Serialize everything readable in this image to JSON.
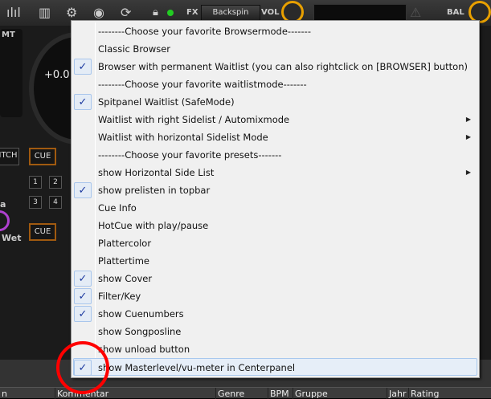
{
  "topbar": {
    "fx_label": "FX",
    "fx_effect": "Backspin",
    "vol_label": "VOL",
    "bal_label": "BAL",
    "icons": [
      "waveform-icon",
      "mixer-icon",
      "gear-icon",
      "eye-icon",
      "refresh-icon",
      "lock-icon",
      "status-led-icon"
    ]
  },
  "deck": {
    "mt_label": "MT",
    "pitch_value": "+0.0",
    "pitch_btn": "ITCH",
    "cue_label": "CUE",
    "cue2_label": "CUE",
    "hotcues": [
      "1",
      "2",
      "3",
      "4"
    ],
    "fx_label_a": "a",
    "wet_label": "Wet"
  },
  "menu": {
    "items": [
      {
        "label": "--------Choose your favorite Browsermode-------",
        "checked": false,
        "submenu": false
      },
      {
        "label": "Classic Browser",
        "checked": false,
        "submenu": false
      },
      {
        "label": "Browser with permanent Waitlist (you can also rightclick on [BROWSER] button)",
        "checked": true,
        "submenu": false
      },
      {
        "label": "--------Choose your favorite waitlistmode-------",
        "checked": false,
        "submenu": false
      },
      {
        "label": "Spitpanel Waitlist (SafeMode)",
        "checked": true,
        "submenu": false
      },
      {
        "label": "Waitlist with right Sidelist / Automixmode",
        "checked": false,
        "submenu": true
      },
      {
        "label": "Waitlist with horizontal Sidelist Mode",
        "checked": false,
        "submenu": true
      },
      {
        "label": "--------Choose your favorite presets-------",
        "checked": false,
        "submenu": false
      },
      {
        "label": "show Horizontal Side List",
        "checked": false,
        "submenu": true
      },
      {
        "label": "show prelisten in topbar",
        "checked": true,
        "submenu": false
      },
      {
        "label": "Cue Info",
        "checked": false,
        "submenu": false
      },
      {
        "label": "HotCue with play/pause",
        "checked": false,
        "submenu": false
      },
      {
        "label": "Plattercolor",
        "checked": false,
        "submenu": false
      },
      {
        "label": "Plattertime",
        "checked": false,
        "submenu": false
      },
      {
        "label": "show Cover",
        "checked": true,
        "submenu": false
      },
      {
        "label": "Filter/Key",
        "checked": true,
        "submenu": false
      },
      {
        "label": "show Cuenumbers",
        "checked": true,
        "submenu": false
      },
      {
        "label": "show Songposline",
        "checked": false,
        "submenu": false
      },
      {
        "label": "show unload button",
        "checked": false,
        "submenu": false
      },
      {
        "label": "show Masterlevel/vu-meter in Centerpanel",
        "checked": true,
        "submenu": false,
        "highlighted": true
      }
    ],
    "check_glyph": "✓",
    "arrow_glyph": "▶"
  },
  "browser": {
    "columns": [
      "n",
      "Kommentar",
      "Genre",
      "BPM",
      "Gruppe",
      "Jahr",
      "Rating"
    ]
  },
  "colors": {
    "accent": "#e8a000",
    "annotation": "#ff0000",
    "check": "#1d3aa0"
  }
}
